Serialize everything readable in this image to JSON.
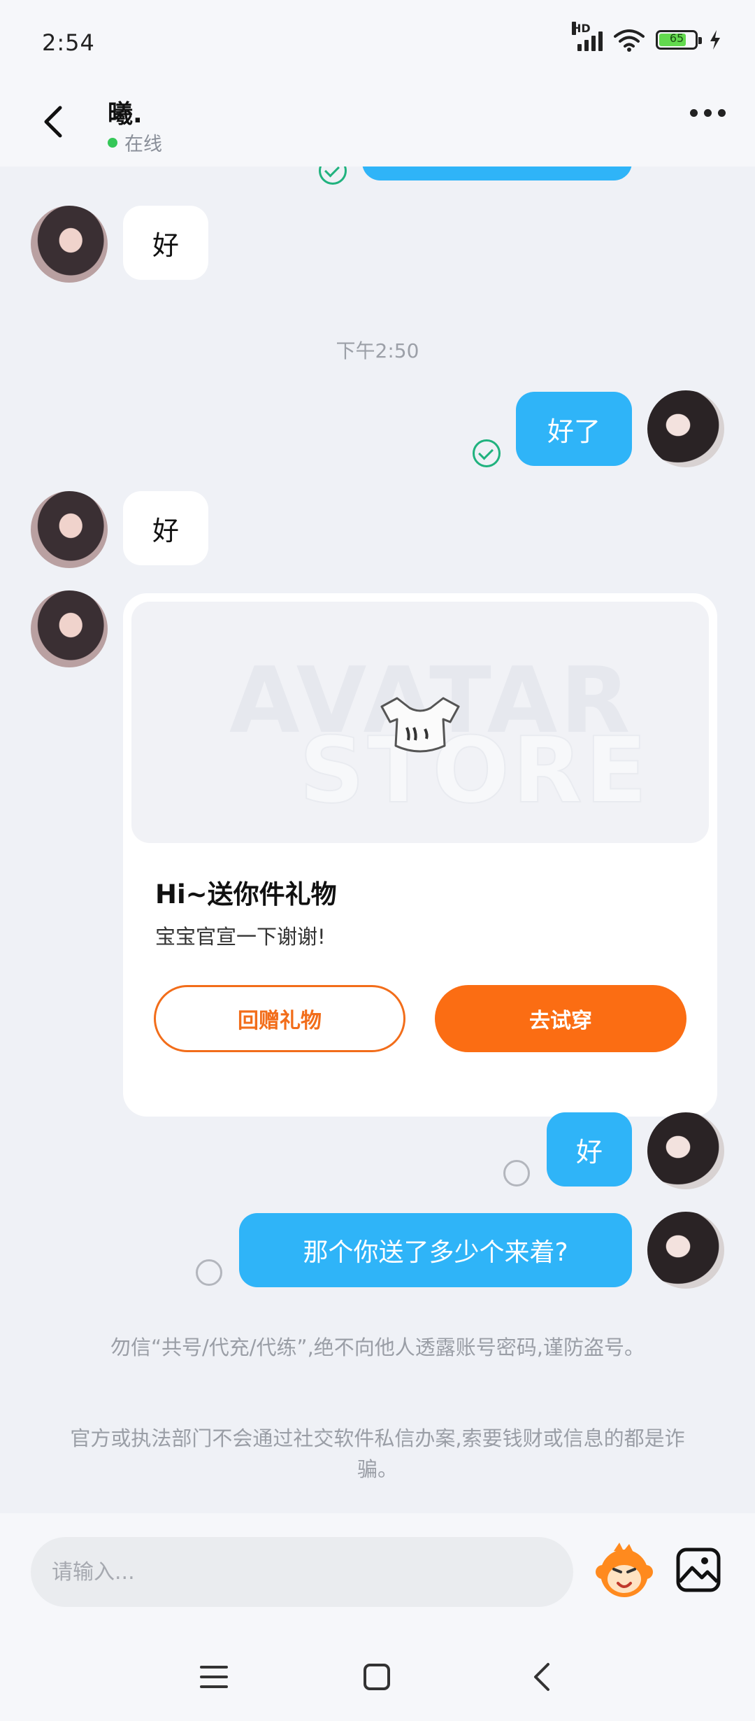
{
  "status_bar": {
    "time": "2:54",
    "network": "HD",
    "battery": "65"
  },
  "header": {
    "contact_name": "曦.",
    "status": "在线"
  },
  "messages": {
    "in_1": "好",
    "timestamp": "下午2:50",
    "out_1": "好了",
    "in_2": "好",
    "out_2": "好",
    "out_3": "那个你送了多少个来着?"
  },
  "gift_card": {
    "watermark_line1": "AVATAR",
    "watermark_line2": "STORE",
    "title": "Hi~送你件礼物",
    "subtitle": "宝宝官宣一下谢谢!",
    "return_button": "回赠礼物",
    "try_button": "去试穿"
  },
  "notices": {
    "line_1": "勿信“共号/代充/代练”,绝不向他人透露账号密码,谨防盗号。",
    "line_2": "官方或执法部门不会通过社交软件私信办案,索要钱财或信息的都是诈骗。"
  },
  "input": {
    "placeholder": "请输入..."
  },
  "icons": {
    "back": "back-arrow-icon",
    "more": "more-dots-icon",
    "emoji": "monkey-emoji-icon",
    "image": "image-icon",
    "delivered": "delivered-check-icon",
    "pending": "pending-circle-icon"
  },
  "colors": {
    "outgoing_bubble": "#2fb4f8",
    "incoming_bubble": "#ffffff",
    "accent_orange": "#fb6d13",
    "online_green": "#35c758",
    "delivered_green": "#20b27e"
  }
}
